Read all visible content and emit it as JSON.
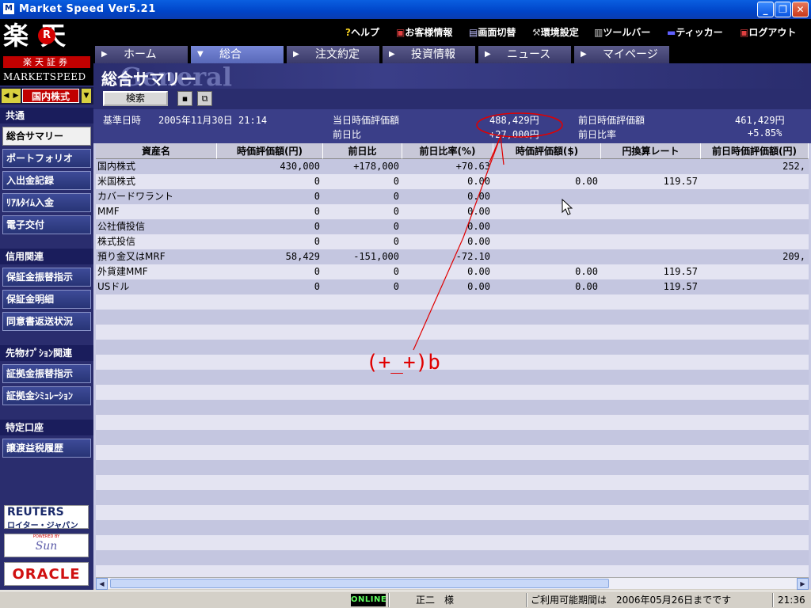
{
  "window": {
    "title": "Market Speed Ver5.21"
  },
  "logo": {
    "kanji": "楽 天",
    "r": "R",
    "sub": "楽天証券",
    "brand": "MARKETSPEED"
  },
  "market_selector": {
    "value": "国内株式"
  },
  "sidebar": {
    "sections": [
      {
        "label": "共通",
        "items": [
          "総合サマリー",
          "ポートフォリオ",
          "入出金記録",
          "ﾘｱﾙﾀｲﾑ入金",
          "電子交付"
        ]
      },
      {
        "label": "信用関連",
        "items": [
          "保証金振替指示",
          "保証金明細",
          "同意書返送状況"
        ]
      },
      {
        "label": "先物ｵﾌﾟｼｮﾝ関連",
        "items": [
          "証拠金振替指示",
          "証拠金ｼﾐｭﾚｰｼｮﾝ"
        ]
      },
      {
        "label": "特定口座",
        "items": [
          "譲渡益税履歴"
        ]
      }
    ],
    "active_item": "総合サマリー",
    "brands": {
      "reuters": "REUTERS",
      "reuters_sub": "ロイター・ジャパン",
      "sun_top": "POWERED BY",
      "sun": "Sun",
      "oracle": "ORACLE"
    }
  },
  "menubar": {
    "items": [
      {
        "icon": "?",
        "label": "ヘルプ"
      },
      {
        "icon": "▣",
        "label": "お客様情報"
      },
      {
        "icon": "▤",
        "label": "画面切替"
      },
      {
        "icon": "⚒",
        "label": "環境設定"
      },
      {
        "icon": "▥",
        "label": "ツールバー"
      },
      {
        "icon": "▬",
        "label": "ティッカー"
      },
      {
        "icon": "▣",
        "label": "ログアウト"
      }
    ]
  },
  "tabs": [
    {
      "label": "ホーム",
      "active": false
    },
    {
      "label": "総合",
      "active": true
    },
    {
      "label": "注文約定",
      "active": false
    },
    {
      "label": "投資情報",
      "active": false
    },
    {
      "label": "ニュース",
      "active": false
    },
    {
      "label": "マイページ",
      "active": false
    }
  ],
  "page": {
    "title": "総合サマリー",
    "bg_text": "General"
  },
  "toolbar": {
    "search_label": "検索",
    "save_icon": "save-icon",
    "copy_icon": "copy-icon"
  },
  "summary": {
    "base_label": "基準日時",
    "base_value": "2005年11月30日 21:14",
    "cur_label": "当日時価評価額",
    "cur_value": "488,429円",
    "diff_label": "前日比",
    "diff_value": "+27,000円",
    "prev_label": "前日時価評価額",
    "prev_value": "461,429円",
    "rate_label": "前日比率",
    "rate_value": "+5.85%"
  },
  "table": {
    "headers": [
      "資産名",
      "時価評価額(円)",
      "前日比",
      "前日比率(%)",
      "時価評価額($)",
      "円換算レート",
      "前日時価評価額(円)"
    ],
    "rows": [
      [
        "国内株式",
        "430,000",
        "+178,000",
        "+70.63",
        "",
        "",
        "252,"
      ],
      [
        "米国株式",
        "0",
        "0",
        "0.00",
        "0.00",
        "119.57",
        ""
      ],
      [
        "カバードワラント",
        "0",
        "0",
        "0.00",
        "",
        "",
        ""
      ],
      [
        "MMF",
        "0",
        "0",
        "0.00",
        "",
        "",
        ""
      ],
      [
        "公社債投信",
        "0",
        "0",
        "0.00",
        "",
        "",
        ""
      ],
      [
        "株式投信",
        "0",
        "0",
        "0.00",
        "",
        "",
        ""
      ],
      [
        "預り金又はMRF",
        "58,429",
        "-151,000",
        "-72.10",
        "",
        "",
        "209,"
      ],
      [
        "外貨建MMF",
        "0",
        "0",
        "0.00",
        "0.00",
        "119.57",
        ""
      ],
      [
        "USドル",
        "0",
        "0",
        "0.00",
        "0.00",
        "119.57",
        ""
      ]
    ]
  },
  "annotation": {
    "text": "(+_+)b",
    "color": "#e00000"
  },
  "statusbar": {
    "online": "ONLINE",
    "user": "正二　様",
    "period": "ご利用可能期間は　2006年05月26日までです",
    "time": "21:36"
  }
}
